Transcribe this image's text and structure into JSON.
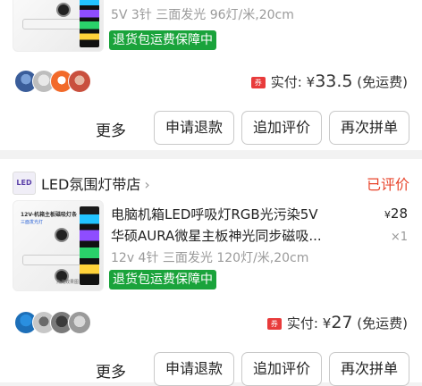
{
  "order1": {
    "specs": "5V 3针 三面发光  96灯/米,20cm",
    "badge": "退货包运费保障中",
    "paid_label": "实付:",
    "currency": "¥",
    "amount": "33.5",
    "shipping": "(免运费)",
    "coupon_icon": "券",
    "more": "更多",
    "buttons": [
      "申请退款",
      "追加评价",
      "再次拼单"
    ]
  },
  "order2": {
    "store_logo": "LED",
    "store_name": "LED氛围灯带店",
    "status": "已评价",
    "title_line1": "电脑机箱LED呼吸灯RGB光污染5V",
    "title_line2": "华硕AURA微星主板神光同步磁吸...",
    "price_currency": "¥",
    "price": "28",
    "quantity": "×1",
    "specs": "12v 4针 三面发光 120灯/米,20cm",
    "badge": "退货包运费保障中",
    "paid_label": "实付:",
    "currency": "¥",
    "amount": "27",
    "shipping": "(免运费)",
    "coupon_icon": "券",
    "more": "更多",
    "buttons": [
      "申请退款",
      "追加评价",
      "再次拼单"
    ]
  },
  "thumb_text": {
    "caption": "12V-机箱主板磁吸灯条",
    "caption2": "三面发光灯",
    "foot": "点亮效果图"
  },
  "colors": {
    "status_red": "#e8452c",
    "badge_green": "#1aa33b",
    "coupon_red": "#e83b3b"
  }
}
